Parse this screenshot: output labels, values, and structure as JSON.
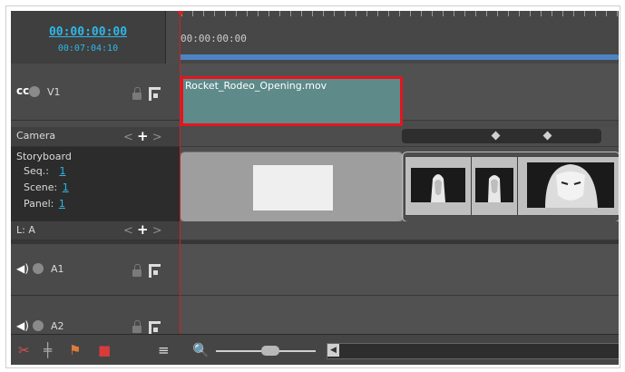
{
  "timecode": {
    "current": "00:00:00:00",
    "duration": "00:07:04:10"
  },
  "ruler": {
    "start_label": "00:00:00:00"
  },
  "tracks": {
    "v1": {
      "label": "V1"
    },
    "camera": {
      "label": "Camera"
    },
    "storyboard": {
      "title": "Storyboard",
      "seq_label": "Seq.:",
      "seq_value": "1",
      "scene_label": "Scene:",
      "scene_value": "1",
      "panel_label": "Panel:",
      "panel_value": "1"
    },
    "layer": {
      "label": "L: A"
    },
    "a1": {
      "label": "A1"
    },
    "a2": {
      "label": "A2"
    }
  },
  "clip": {
    "name": "Rocket_Rodeo_Opening.mov"
  },
  "controls": {
    "prev": "<",
    "add": "+",
    "next": ">"
  },
  "colors": {
    "timecode": "#2fb7e6",
    "playhead": "#d61f1f",
    "selection": "#e2161e",
    "clip": "#5e8a8a",
    "ruler_bar": "#4e84c4"
  },
  "icons": [
    "film-reel-icon",
    "eye-dot-icon",
    "lock-icon",
    "snap-icon",
    "speaker-icon",
    "split-clip-icon",
    "insert-icon",
    "marker-icon",
    "menu-icon",
    "zoom-icon"
  ]
}
